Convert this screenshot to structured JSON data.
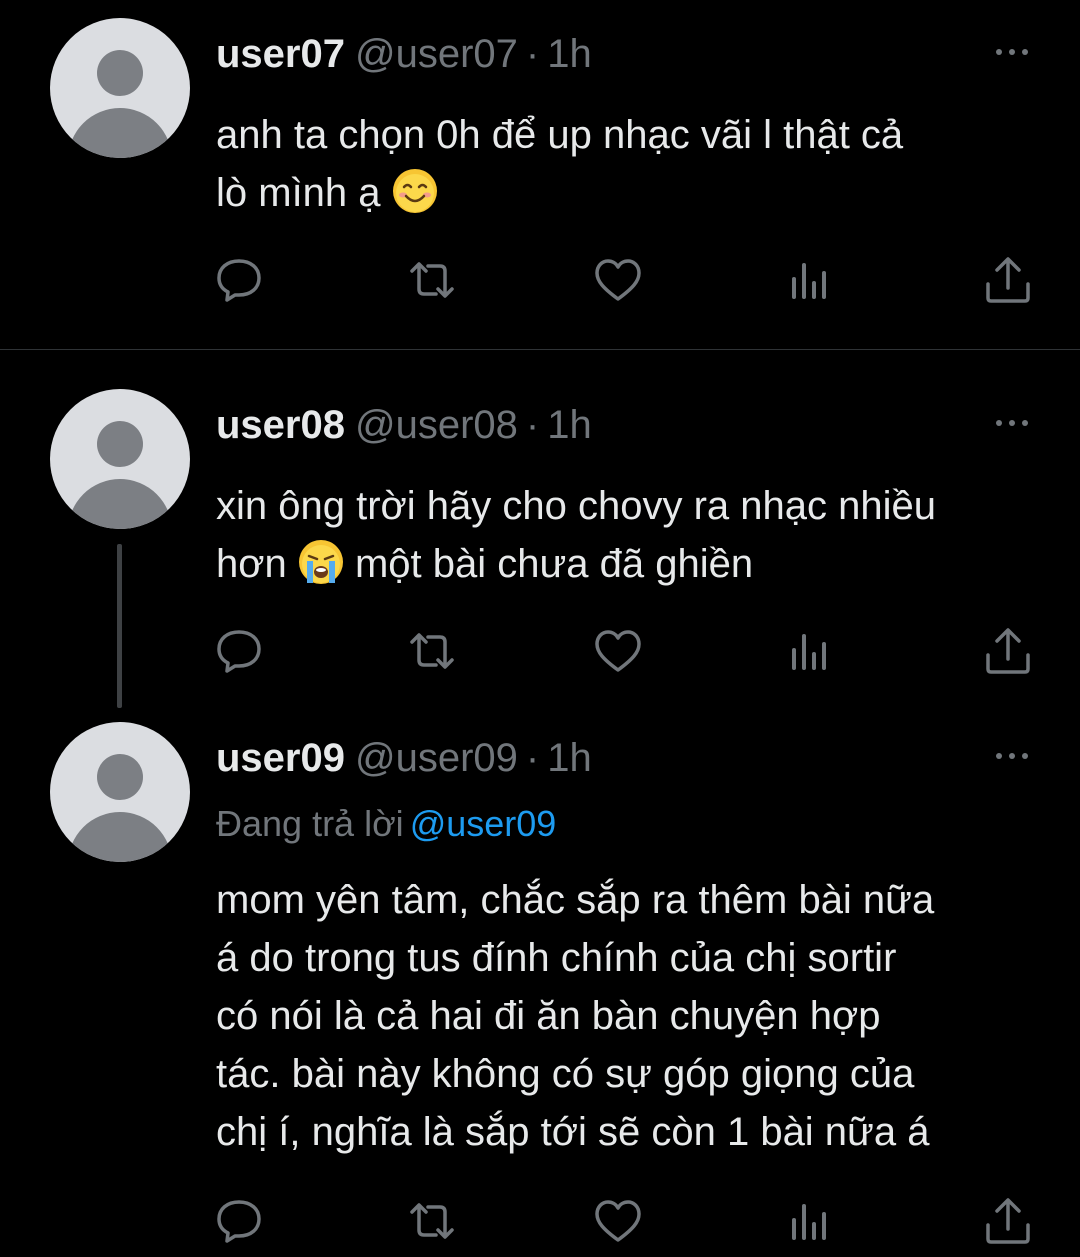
{
  "tweets": [
    {
      "name": "user07",
      "handle": "@user07",
      "time": "1h",
      "text_line1": "anh ta chọn 0h để up nhạc vãi l thật cả",
      "text_line2": "lò mình ạ"
    },
    {
      "name": "user08",
      "handle": "@user08",
      "time": "1h",
      "text_line1": "xin ông trời hãy cho chovy ra nhạc nhiều",
      "text_line2_a": "hơn",
      "text_line2_b": "một bài chưa đã ghiền"
    },
    {
      "name": "user09",
      "handle": "@user09",
      "time": "1h",
      "replying_label": "Đang trả lời",
      "replying_mention": "@user09",
      "text_lines": [
        "mom yên tâm, chắc sắp ra thêm bài nữa",
        "á do trong tus đính chính của chị sortir",
        "có nói là cả hai đi ăn bàn chuyện hợp",
        "tác. bài này không có sự góp giọng của",
        "chị í, nghĩa là sắp tới sẽ còn 1 bài nữa á"
      ]
    }
  ],
  "separator": "·",
  "icons": {
    "reply": "reply-icon",
    "retweet": "retweet-icon",
    "like": "like-icon",
    "views": "views-icon",
    "share": "share-icon",
    "more": "more-icon"
  },
  "colors": {
    "background": "#000000",
    "text": "#e7e9ea",
    "secondary": "#71767b",
    "link": "#1d9bf0"
  }
}
